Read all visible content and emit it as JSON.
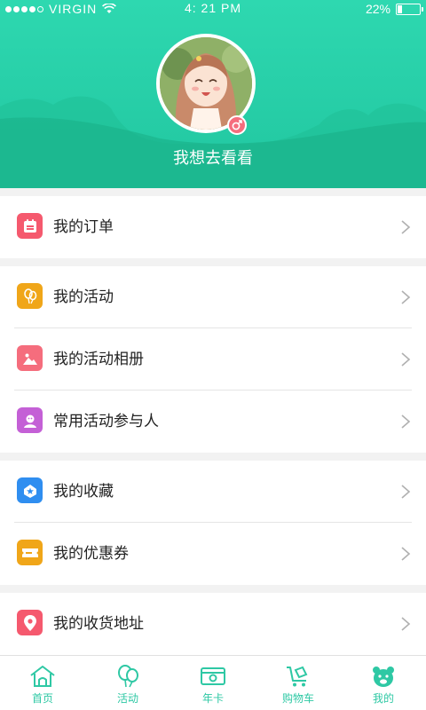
{
  "status_bar": {
    "carrier": "VIRGIN",
    "time": "4: 21 PM",
    "battery": "22%",
    "battery_level": 0.22
  },
  "profile": {
    "nickname": "我想去看看"
  },
  "menu": {
    "orders": {
      "label": "我的订单",
      "icon": "calendar-icon",
      "color": "#f5596e"
    },
    "activities": {
      "label": "我的活动",
      "icon": "balloon-icon",
      "color": "#f0a619"
    },
    "album": {
      "label": "我的活动相册",
      "icon": "picture-icon",
      "color": "#f56d7d"
    },
    "participants": {
      "label": "常用活动参与人",
      "icon": "person-icon",
      "color": "#c460d6"
    },
    "favorites": {
      "label": "我的收藏",
      "icon": "star-icon",
      "color": "#2f8ef0"
    },
    "coupons": {
      "label": "我的优惠券",
      "icon": "coupon-icon",
      "color": "#f0a619"
    },
    "address": {
      "label": "我的收货地址",
      "icon": "location-icon",
      "color": "#f5596e"
    }
  },
  "tabbar": {
    "home": "首页",
    "activity": "活动",
    "card": "年卡",
    "cart": "购物车",
    "mine": "我的"
  },
  "colors": {
    "accent": "#2ec8a4",
    "header": "#25cca4"
  }
}
